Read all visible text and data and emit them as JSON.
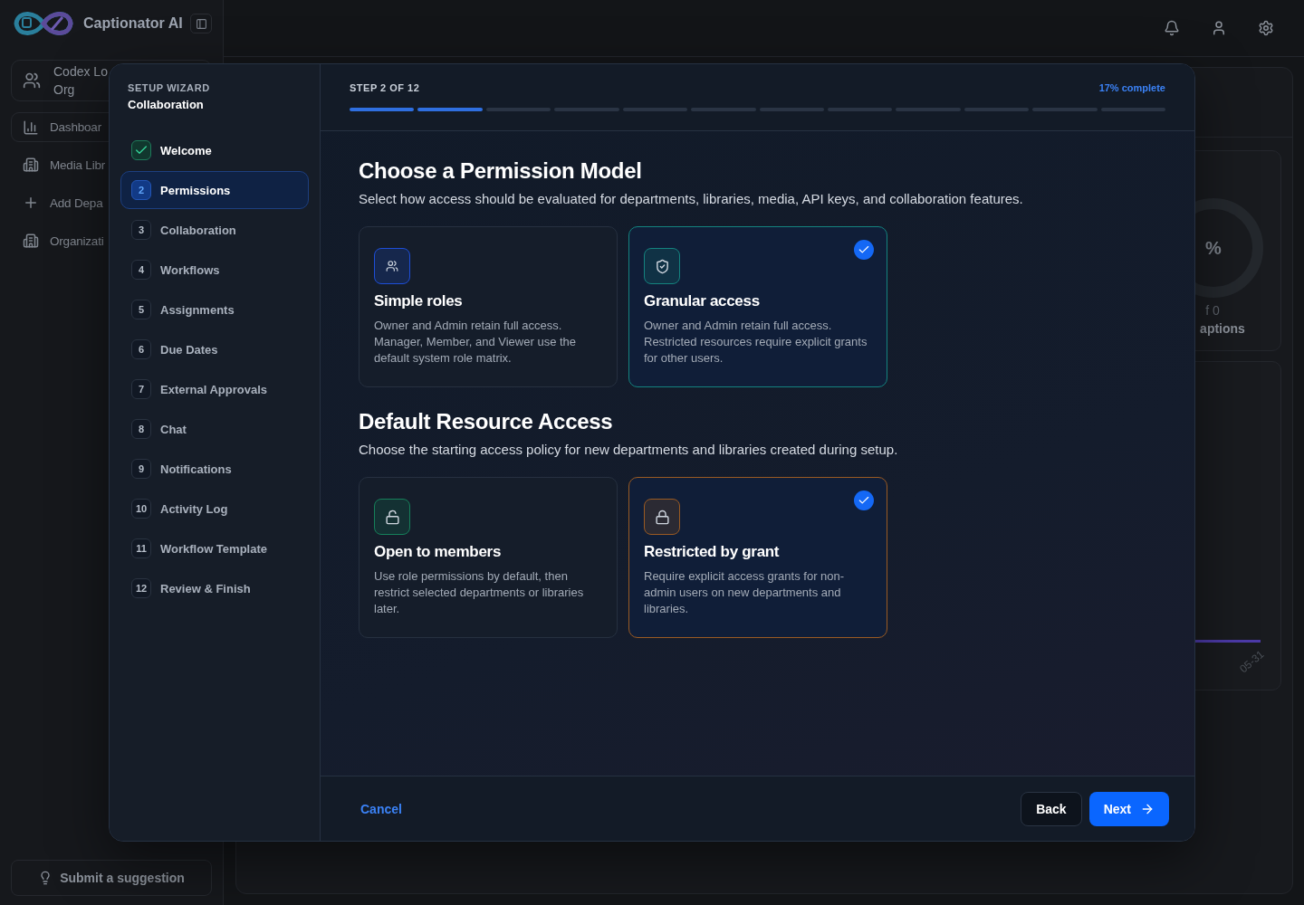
{
  "app": {
    "name": "Captionator AI"
  },
  "sidebar": {
    "org_lines": [
      "Codex Lo",
      "Org"
    ],
    "items": [
      {
        "kind": "chart",
        "label": "Dashboar",
        "selected": true
      },
      {
        "kind": "building",
        "label": "Media Libr",
        "selected": false
      },
      {
        "kind": "add",
        "label": "Add Depa",
        "selected": false
      },
      {
        "kind": "building",
        "label": "Organizati",
        "selected": false
      }
    ],
    "footer": "Submit a suggestion"
  },
  "background": {
    "stat": {
      "value": "%",
      "sub": "f 0",
      "label": "aptions"
    },
    "chart": {
      "x_label": "05-31"
    }
  },
  "wizard": {
    "eyebrow": "SETUP WIZARD",
    "subtitle": "Collaboration",
    "steps": [
      {
        "label": "Welcome",
        "done": true,
        "selected": false
      },
      {
        "number": "2",
        "label": "Permissions",
        "done": false,
        "selected": true
      },
      {
        "number": "3",
        "label": "Collaboration",
        "done": false,
        "selected": false
      },
      {
        "number": "4",
        "label": "Workflows",
        "done": false,
        "selected": false
      },
      {
        "number": "5",
        "label": "Assignments",
        "done": false,
        "selected": false
      },
      {
        "number": "6",
        "label": "Due Dates",
        "done": false,
        "selected": false
      },
      {
        "number": "7",
        "label": "External Approvals",
        "done": false,
        "selected": false
      },
      {
        "number": "8",
        "label": "Chat",
        "done": false,
        "selected": false
      },
      {
        "number": "9",
        "label": "Notifications",
        "done": false,
        "selected": false
      },
      {
        "number": "10",
        "label": "Activity Log",
        "done": false,
        "selected": false
      },
      {
        "number": "11",
        "label": "Workflow Template",
        "done": false,
        "selected": false
      },
      {
        "number": "12",
        "label": "Review & Finish",
        "done": false,
        "selected": false
      }
    ],
    "step_label": "STEP 2 OF 12",
    "progress_label": "17% complete",
    "segments": [
      {
        "filled": true
      },
      {
        "filled": true
      },
      {
        "filled": false
      },
      {
        "filled": false
      },
      {
        "filled": false
      },
      {
        "filled": false
      },
      {
        "filled": false
      },
      {
        "filled": false
      },
      {
        "filled": false
      },
      {
        "filled": false
      },
      {
        "filled": false
      },
      {
        "filled": false
      }
    ],
    "sections": [
      {
        "title": "Choose a Permission Model",
        "description": "Select how access should be evaluated for departments, libraries, media, API keys, and collaboration features.",
        "options": [
          {
            "kind": "people",
            "title": "Simple roles",
            "description": "Owner and Admin retain full access. Manager, Member, and Viewer use the default system role matrix.",
            "selected": false,
            "color": "#1d4ed8"
          },
          {
            "kind": "shield",
            "title": "Granular access",
            "description": "Owner and Admin retain full access. Restricted resources require explicit grants for other users.",
            "selected": true,
            "color": "#14837f"
          }
        ]
      },
      {
        "title": "Default Resource Access",
        "description": "Choose the starting access policy for new departments and libraries created during setup.",
        "options": [
          {
            "kind": "unlock",
            "title": "Open to members",
            "description": "Use role permissions by default, then restrict selected departments or libraries later.",
            "selected": false,
            "color": "#15805a"
          },
          {
            "kind": "lock",
            "title": "Restricted by grant",
            "description": "Require explicit access grants for non-admin users on new departments and libraries.",
            "selected": true,
            "color": "#9a5a22"
          }
        ]
      }
    ],
    "cancel": "Cancel",
    "back": "Back",
    "next": "Next"
  }
}
